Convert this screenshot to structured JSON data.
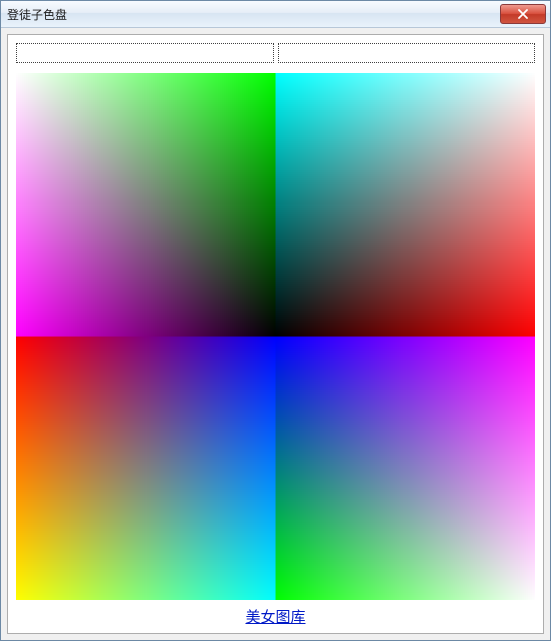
{
  "window": {
    "title": "登徒子色盘"
  },
  "inputs": {
    "left_value": "",
    "right_value": ""
  },
  "link": {
    "label": "美女图库"
  },
  "palette": {
    "quadrants": {
      "top_left": {
        "type": "rgb_cube_face",
        "fixed": "B=0",
        "x_axis": "G 0→255",
        "y_axis": "R 255→0",
        "corners": {
          "tl": "#FFFFFF",
          "tr": "#00FF00",
          "bl": "#FF00FF",
          "br": "#000000"
        }
      },
      "top_right": {
        "type": "rgb_cube_face",
        "fixed": "G=255",
        "x_axis": "B 255→0",
        "y_axis": "R 0→255",
        "corners": {
          "tl": "#00FFFF",
          "tr": "#FFFFFF",
          "bl": "#000000",
          "br": "#FF0000"
        }
      },
      "bottom_left": {
        "type": "rgb_cube_face",
        "fixed": "G=0",
        "x_axis": "B 0→255",
        "y_axis": "R 255→0",
        "corners": {
          "tl": "#FF0000",
          "tr": "#0000FF",
          "bl": "#FFFF00",
          "br": "#00FFFF"
        }
      },
      "bottom_right": {
        "type": "rgb_cube_face",
        "fixed": "B=255",
        "x_axis": "G 255→0",
        "y_axis": "R 0→255",
        "corners": {
          "tl": "#0000FF",
          "tr": "#FF00FF",
          "bl": "#00FF00",
          "br": "#FFFFFF"
        }
      }
    }
  }
}
